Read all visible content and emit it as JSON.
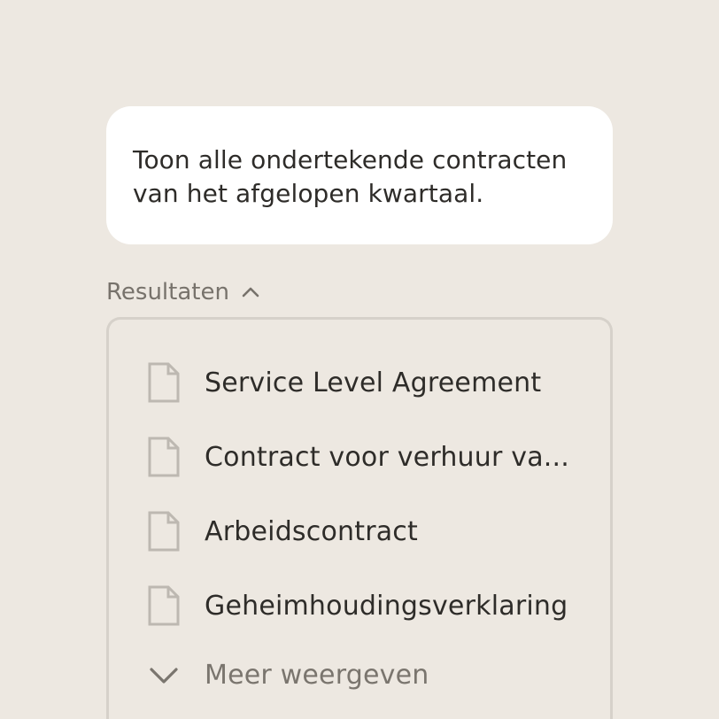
{
  "prompt": {
    "text": "Toon alle ondertekende contracten\nvan het afgelopen kwartaal."
  },
  "results": {
    "label": "Resultaten",
    "toggle_icon": "chevron-up-icon",
    "items": [
      {
        "label": "Service Level Agreement",
        "icon": "document-icon"
      },
      {
        "label": "Contract voor verhuur va...",
        "icon": "document-icon"
      },
      {
        "label": "Arbeidscontract",
        "icon": "document-icon"
      },
      {
        "label": "Geheimhoudingsverklaring",
        "icon": "document-icon"
      }
    ],
    "show_more": {
      "label": "Meer weergeven",
      "icon": "chevron-down-icon"
    }
  },
  "colors": {
    "background": "#ede8e1",
    "bubble": "#ffffff",
    "text": "#2e2c29",
    "muted_text": "#77726b",
    "border": "#d6d1ca",
    "icon": "#bdb8b1"
  }
}
